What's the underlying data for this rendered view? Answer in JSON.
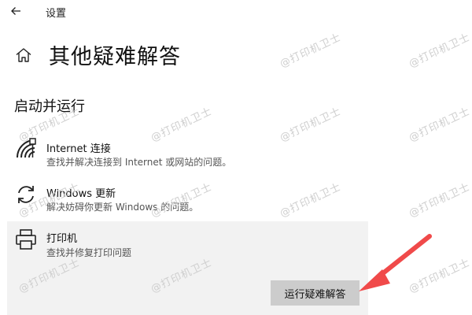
{
  "window": {
    "title": "设置"
  },
  "header": {
    "title": "其他疑难解答"
  },
  "section": {
    "title": "启动并运行"
  },
  "items": [
    {
      "name": "Internet 连接",
      "description": "查找并解决连接到 Internet 或网站的问题。",
      "icon": "wifi-icon"
    },
    {
      "name": "Windows 更新",
      "description": "解决妨碍你更新 Windows 的问题。",
      "icon": "refresh-icon"
    },
    {
      "name": "打印机",
      "description": "查找并修复打印问题",
      "icon": "printer-icon"
    }
  ],
  "actions": {
    "run_troubleshooter": "运行疑难解答"
  },
  "watermark": {
    "text": "@打印机卫士"
  },
  "colors": {
    "selected_bg": "#f2f2f2",
    "button_bg": "#cccccc",
    "arrow": "#f04a4a"
  }
}
